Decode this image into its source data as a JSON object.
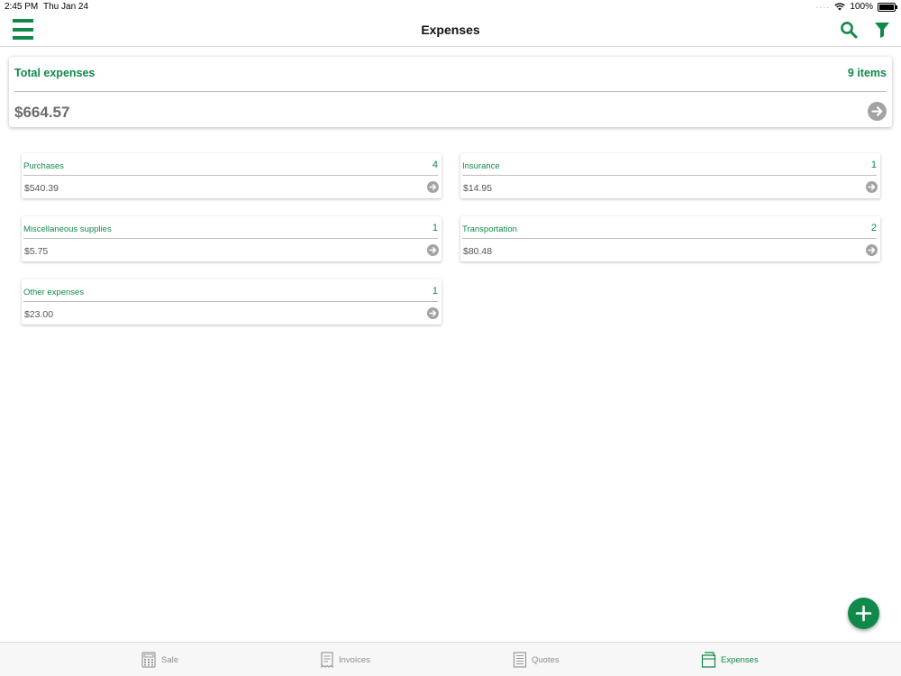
{
  "status_bar": {
    "time": "2:45 PM",
    "date": "Thu Jan 24",
    "battery": "100%"
  },
  "header": {
    "title": "Expenses",
    "icons": [
      "menu-icon",
      "search-icon",
      "filter-icon"
    ]
  },
  "summary": {
    "label": "Total expenses",
    "count": "9 items",
    "amount": "$664.57"
  },
  "categories": [
    {
      "name": "Purchases",
      "count": "4",
      "amount": "$540.39"
    },
    {
      "name": "Insurance",
      "count": "1",
      "amount": "$14.95"
    },
    {
      "name": "Miscellaneous supplies",
      "count": "1",
      "amount": "$5.75"
    },
    {
      "name": "Transportation",
      "count": "2",
      "amount": "$80.48"
    },
    {
      "name": "Other expenses",
      "count": "1",
      "amount": "$23.00"
    }
  ],
  "tabs": [
    {
      "label": "Sale",
      "icon": "register-icon",
      "active": false
    },
    {
      "label": "Invoices",
      "icon": "invoice-icon",
      "active": false
    },
    {
      "label": "Quotes",
      "icon": "quote-icon",
      "active": false
    },
    {
      "label": "Expenses",
      "icon": "expenses-icon",
      "active": true
    }
  ],
  "colors": {
    "accent": "#0f8a4a",
    "muted_text": "#6b6b6b",
    "inactive_tab": "#8e8e8e"
  }
}
